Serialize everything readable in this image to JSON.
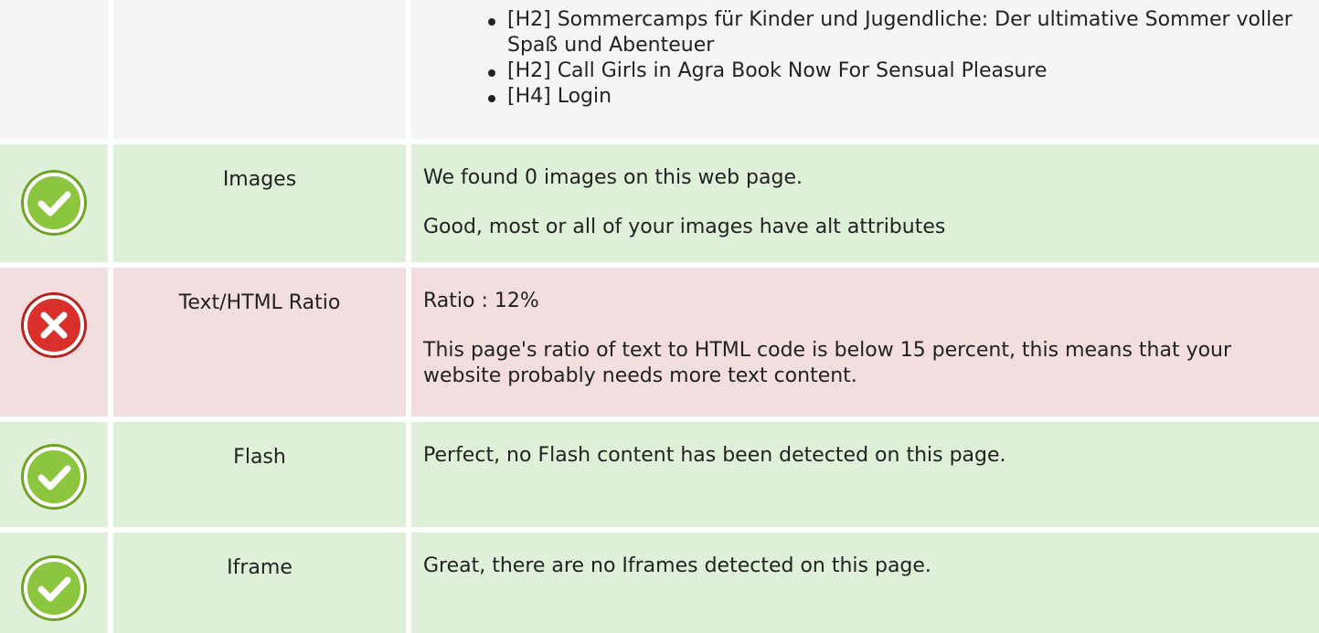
{
  "top_section": {
    "headings": [
      "[H2] Sommercamps für Kinder und Jugendliche: Der ultimative Sommer voller Spaß und Abenteuer",
      "[H2] Call Girls in Agra Book Now For Sensual Pleasure",
      "[H4] Login"
    ]
  },
  "rows": [
    {
      "status": "good",
      "label": "Images",
      "lines": [
        "We found 0 images on this web page.",
        "Good, most or all of your images have alt attributes"
      ]
    },
    {
      "status": "bad",
      "label": "Text/HTML Ratio",
      "lines": [
        "Ratio : 12%",
        "This page's ratio of text to HTML code is below 15 percent, this means that your website probably needs more text content."
      ]
    },
    {
      "status": "good",
      "label": "Flash",
      "lines": [
        "Perfect, no Flash content has been detected on this page."
      ]
    },
    {
      "status": "good",
      "label": "Iframe",
      "lines": [
        "Great, there are no Iframes detected on this page."
      ]
    }
  ],
  "colors": {
    "good_bg": "#dff0d8",
    "bad_bg": "#f2dede",
    "neutral_bg": "#f5f5f5",
    "good_icon": "#8cc63f",
    "bad_icon": "#d9302c"
  },
  "icons": {
    "good": "check-circle-icon",
    "bad": "x-circle-icon"
  }
}
